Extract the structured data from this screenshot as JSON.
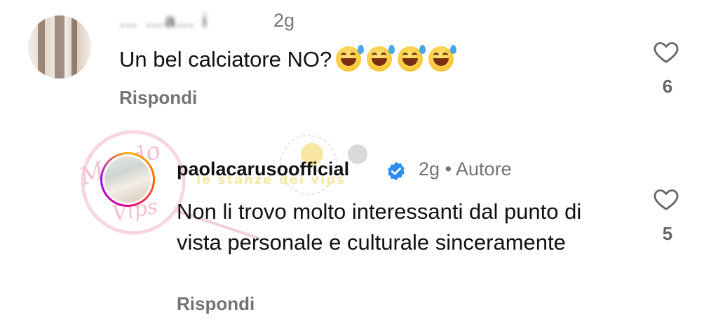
{
  "comments": [
    {
      "username": "… …a… i",
      "time": "2g",
      "text": "Un bel calciatore NO?",
      "emojis": [
        "grinning-sweat-emoji",
        "grinning-sweat-emoji",
        "grinning-sweat-emoji",
        "grinning-sweat-emoji"
      ],
      "reply_label": "Rispondi",
      "likes": "6",
      "icons": {
        "like": "heart-outline-icon"
      }
    },
    {
      "username": "paolacarusoofficial",
      "time": "2g",
      "separator": "•",
      "role": "Autore",
      "text": "Non li trovo molto interessanti dal punto di vista personale e culturale sinceramente",
      "reply_label": "Rispondi",
      "likes": "5",
      "icons": {
        "verified": "verified-badge-icon",
        "like": "heart-outline-icon"
      }
    }
  ],
  "watermark": {
    "script": "Mondo Vips",
    "text": "le stanze dei vips"
  },
  "colors": {
    "verified": "#2d8cf0",
    "muted": "#737373",
    "text": "#111111"
  }
}
